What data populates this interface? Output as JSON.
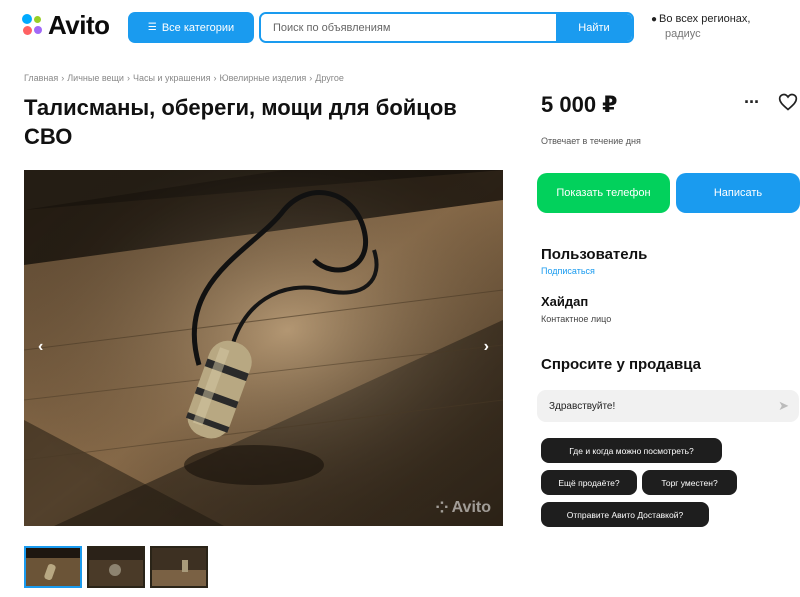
{
  "header": {
    "logo_text": "Avito",
    "categories_label": "Все категории",
    "search_placeholder": "Поиск по объявлениям",
    "search_button": "Найти",
    "region_label": "Во всех регионах,",
    "radius_label": "радиус"
  },
  "breadcrumb": [
    "Главная",
    "Личные вещи",
    "Часы и украшения",
    "Ювелирные изделия",
    "Другое"
  ],
  "listing": {
    "title": "Талисманы, обереги, мощи для бойцов СВО",
    "price": "5 000 ₽",
    "response_time": "Отвечает в течение дня",
    "photo_watermark": "Avito",
    "thumbnail_count": 3,
    "active_thumbnail": 1
  },
  "actions": {
    "show_phone": "Показать телефон",
    "write": "Написать"
  },
  "seller": {
    "name": "Пользователь",
    "subscribe": "Подписаться",
    "contact_name": "Хайдап",
    "contact_role": "Контактное лицо"
  },
  "ask": {
    "title": "Спросите у продавца",
    "message_value": "Здравствуйте!",
    "quick_questions": [
      "Где и когда можно посмотреть?",
      "Ещё продаёте?",
      "Торг уместен?",
      "Отправите Авито Доставкой?"
    ]
  },
  "colors": {
    "accent_blue": "#1a9bef",
    "phone_green": "#02d15c",
    "chip_dark": "#1e1e1e"
  }
}
